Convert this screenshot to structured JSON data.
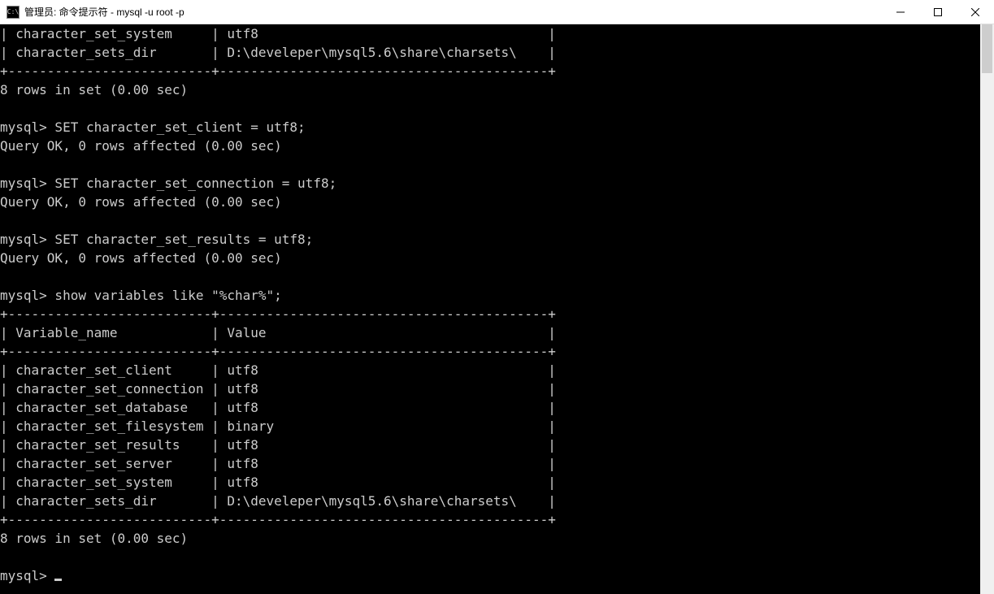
{
  "window": {
    "icon_text": "C:\\",
    "title": "管理员: 命令提示符 - mysql  -u root -p"
  },
  "terminal": {
    "top_table": {
      "rows": [
        {
          "name": "character_set_system",
          "value": "utf8"
        },
        {
          "name": "character_sets_dir",
          "value": "D:\\develeper\\mysql5.6\\share\\charsets\\"
        }
      ]
    },
    "rows_in_set_1": "8 rows in set (0.00 sec)",
    "prompt": "mysql>",
    "cmd1": "SET character_set_client = utf8;",
    "result1": "Query OK, 0 rows affected (0.00 sec)",
    "cmd2": "SET character_set_connection = utf8;",
    "result2": "Query OK, 0 rows affected (0.00 sec)",
    "cmd3": "SET character_set_results = utf8;",
    "result3": "Query OK, 0 rows affected (0.00 sec)",
    "cmd4": "show variables like \"%char%\";",
    "table": {
      "header_name": "Variable_name",
      "header_value": "Value",
      "rows": [
        {
          "name": "character_set_client",
          "value": "utf8"
        },
        {
          "name": "character_set_connection",
          "value": "utf8"
        },
        {
          "name": "character_set_database",
          "value": "utf8"
        },
        {
          "name": "character_set_filesystem",
          "value": "binary"
        },
        {
          "name": "character_set_results",
          "value": "utf8"
        },
        {
          "name": "character_set_server",
          "value": "utf8"
        },
        {
          "name": "character_set_system",
          "value": "utf8"
        },
        {
          "name": "character_sets_dir",
          "value": "D:\\develeper\\mysql5.6\\share\\charsets\\"
        }
      ]
    },
    "rows_in_set_2": "8 rows in set (0.00 sec)"
  }
}
